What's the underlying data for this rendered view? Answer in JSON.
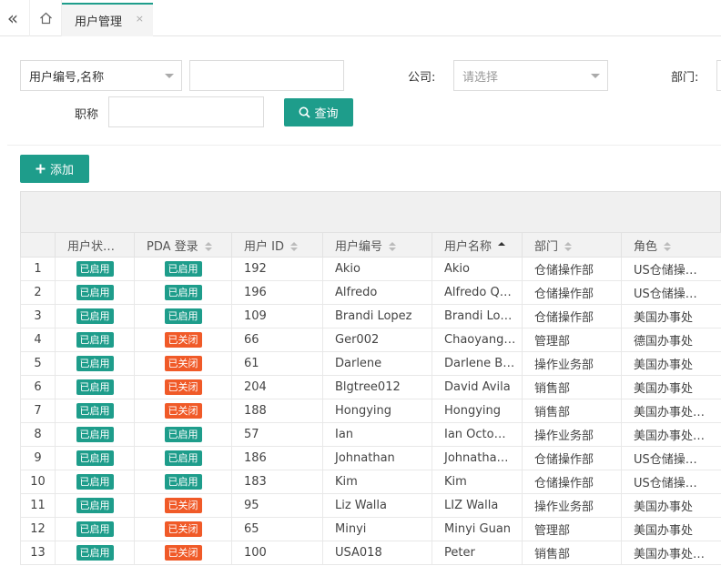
{
  "tabbar": {
    "collapse_glyph": "«",
    "home_icon": "home-icon",
    "active_tab": {
      "label": "用户管理",
      "close_glyph": "×"
    }
  },
  "search": {
    "field_select": {
      "value": "用户编号,名称"
    },
    "keyword_input": {
      "value": "",
      "placeholder": ""
    },
    "company_label": "公司:",
    "company_select": {
      "placeholder": "请选择"
    },
    "department_label": "部门:",
    "title_label": "职称",
    "title_input": {
      "value": "",
      "placeholder": ""
    },
    "query_button": "查询"
  },
  "toolbar": {
    "add_button": "添加"
  },
  "colors": {
    "accent": "#1e9d8b",
    "disabled_badge": "#f05a28"
  },
  "table": {
    "columns": [
      {
        "label": "",
        "sortable": false
      },
      {
        "label": "用户状…",
        "sortable": false
      },
      {
        "label": "PDA 登录",
        "sortable": true
      },
      {
        "label": "用户 ID",
        "sortable": true
      },
      {
        "label": "用户编号",
        "sortable": true
      },
      {
        "label": "用户名称",
        "sortable": true,
        "sort": "asc"
      },
      {
        "label": "部门",
        "sortable": true
      },
      {
        "label": "角色",
        "sortable": true
      }
    ],
    "rows": [
      {
        "n": "1",
        "status": "已启用",
        "status_on": true,
        "pda": "已启用",
        "pda_on": true,
        "id": "192",
        "code": "Akio",
        "name": "Akio",
        "dept": "仓储操作部",
        "role": "US仓储操…"
      },
      {
        "n": "2",
        "status": "已启用",
        "status_on": true,
        "pda": "已启用",
        "pda_on": true,
        "id": "196",
        "code": "Alfredo",
        "name": "Alfredo Q…",
        "dept": "仓储操作部",
        "role": "US仓储操…"
      },
      {
        "n": "3",
        "status": "已启用",
        "status_on": true,
        "pda": "已启用",
        "pda_on": true,
        "id": "109",
        "code": "Brandi Lopez",
        "name": "Brandi Lo…",
        "dept": "仓储操作部",
        "role": "美国办事处"
      },
      {
        "n": "4",
        "status": "已启用",
        "status_on": true,
        "pda": "已关闭",
        "pda_on": false,
        "id": "66",
        "code": "Ger002",
        "name": "Chaoyang…",
        "dept": "管理部",
        "role": "德国办事处"
      },
      {
        "n": "5",
        "status": "已启用",
        "status_on": true,
        "pda": "已关闭",
        "pda_on": false,
        "id": "61",
        "code": "Darlene",
        "name": "Darlene B…",
        "dept": "操作业务部",
        "role": "美国办事处"
      },
      {
        "n": "6",
        "status": "已启用",
        "status_on": true,
        "pda": "已关闭",
        "pda_on": false,
        "id": "204",
        "code": "Blgtree012",
        "name": "David Avila",
        "dept": "销售部",
        "role": "美国办事处"
      },
      {
        "n": "7",
        "status": "已启用",
        "status_on": true,
        "pda": "已关闭",
        "pda_on": false,
        "id": "188",
        "code": "Hongying",
        "name": "Hongying",
        "dept": "销售部",
        "role": "美国办事处…"
      },
      {
        "n": "8",
        "status": "已启用",
        "status_on": true,
        "pda": "已启用",
        "pda_on": true,
        "id": "57",
        "code": "Ian",
        "name": "Ian Octo…",
        "dept": "操作业务部",
        "role": "美国办事处…"
      },
      {
        "n": "9",
        "status": "已启用",
        "status_on": true,
        "pda": "已启用",
        "pda_on": true,
        "id": "186",
        "code": "Johnathan",
        "name": "Johnatha…",
        "dept": "仓储操作部",
        "role": "US仓储操…"
      },
      {
        "n": "10",
        "status": "已启用",
        "status_on": true,
        "pda": "已启用",
        "pda_on": true,
        "id": "183",
        "code": "Kim",
        "name": "Kim",
        "dept": "仓储操作部",
        "role": "US仓储操…"
      },
      {
        "n": "11",
        "status": "已启用",
        "status_on": true,
        "pda": "已关闭",
        "pda_on": false,
        "id": "95",
        "code": "Liz Walla",
        "name": "LIZ Walla",
        "dept": "操作业务部",
        "role": "美国办事处"
      },
      {
        "n": "12",
        "status": "已启用",
        "status_on": true,
        "pda": "已关闭",
        "pda_on": false,
        "id": "65",
        "code": "Minyi",
        "name": "Minyi Guan",
        "dept": "管理部",
        "role": "美国办事处"
      },
      {
        "n": "13",
        "status": "已启用",
        "status_on": true,
        "pda": "已关闭",
        "pda_on": false,
        "id": "100",
        "code": "USA018",
        "name": "Peter",
        "dept": "销售部",
        "role": "美国办事处…"
      }
    ]
  }
}
